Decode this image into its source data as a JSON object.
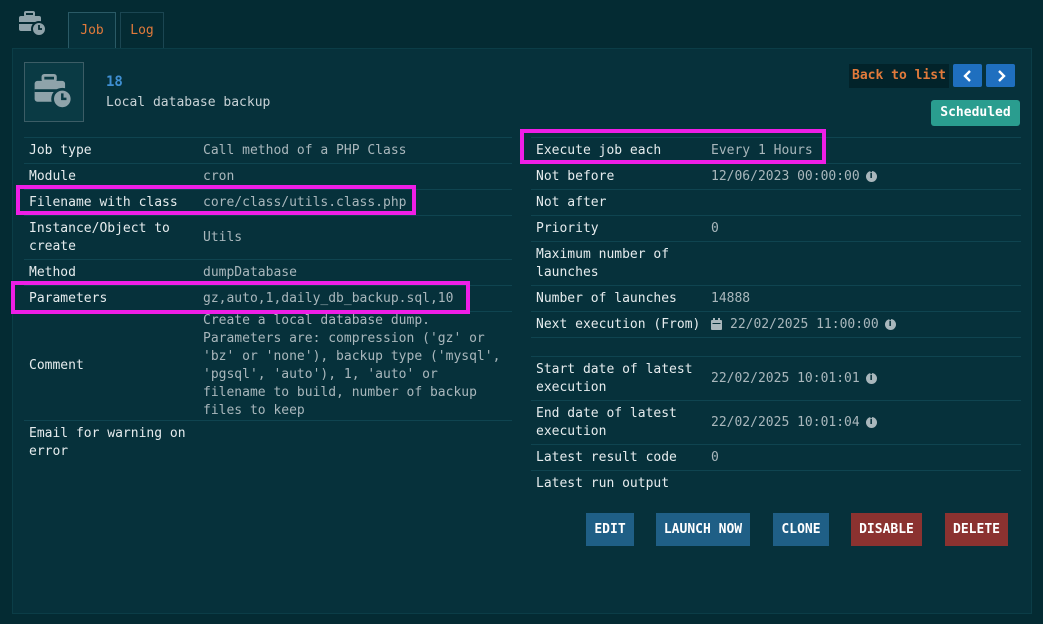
{
  "tabs": [
    {
      "label": "Job"
    },
    {
      "label": "Log"
    }
  ],
  "job": {
    "id": "18",
    "label": "Local database backup"
  },
  "nav": {
    "back_label": "Back to list"
  },
  "status": {
    "label": "Scheduled",
    "color": "#2a9d8f"
  },
  "left_fields": [
    {
      "label": "Job type",
      "value": "Call method of a PHP Class"
    },
    {
      "label": "Module",
      "value": "cron"
    },
    {
      "label": "Filename with class",
      "value": "core/class/utils.class.php"
    },
    {
      "label": "Instance/Object to create",
      "value": "Utils"
    },
    {
      "label": "Method",
      "value": "dumpDatabase"
    },
    {
      "label": "Parameters",
      "value": "gz,auto,1,daily_db_backup.sql,10"
    },
    {
      "label": "Comment",
      "value": "Create a local database dump. Parameters are: compression ('gz' or 'bz' or 'none'), backup type ('mysql', 'pgsql', 'auto'), 1, 'auto' or filename to build, number of backup files to keep"
    },
    {
      "label": "Email for warning on error",
      "value": ""
    }
  ],
  "right_fields": [
    {
      "label": "Execute job each",
      "value": "Every 1 Hours"
    },
    {
      "label": "Not before",
      "value": "12/06/2023 00:00:00"
    },
    {
      "label": "Not after",
      "value": ""
    },
    {
      "label": "Priority",
      "value": "0"
    },
    {
      "label": "Maximum number of launches",
      "value": ""
    },
    {
      "label": "Number of launches",
      "value": "14888"
    },
    {
      "label": "Next execution (From)",
      "value": "22/02/2025 11:00:00"
    },
    {
      "label": "",
      "value": ""
    },
    {
      "label": "Start date of latest execution",
      "value": "22/02/2025 10:01:01"
    },
    {
      "label": "End date of latest execution",
      "value": "22/02/2025 10:01:04"
    },
    {
      "label": "Latest result code",
      "value": "0"
    },
    {
      "label": "Latest run output",
      "value": ""
    }
  ],
  "actions": {
    "edit": "EDIT",
    "launch_now": "LAUNCH NOW",
    "clone": "CLONE",
    "disable": "DISABLE",
    "delete": "DELETE"
  },
  "colors": {
    "accent_orange": "#e17a3b",
    "link_blue": "#3f8fd2",
    "highlight": "#ee1ee6",
    "button_blue": "#1f5f86",
    "button_red": "#8b3230"
  },
  "icons": {
    "app": "briefcase-clock-icon",
    "info": "info-icon",
    "calendar": "calendar-icon"
  }
}
